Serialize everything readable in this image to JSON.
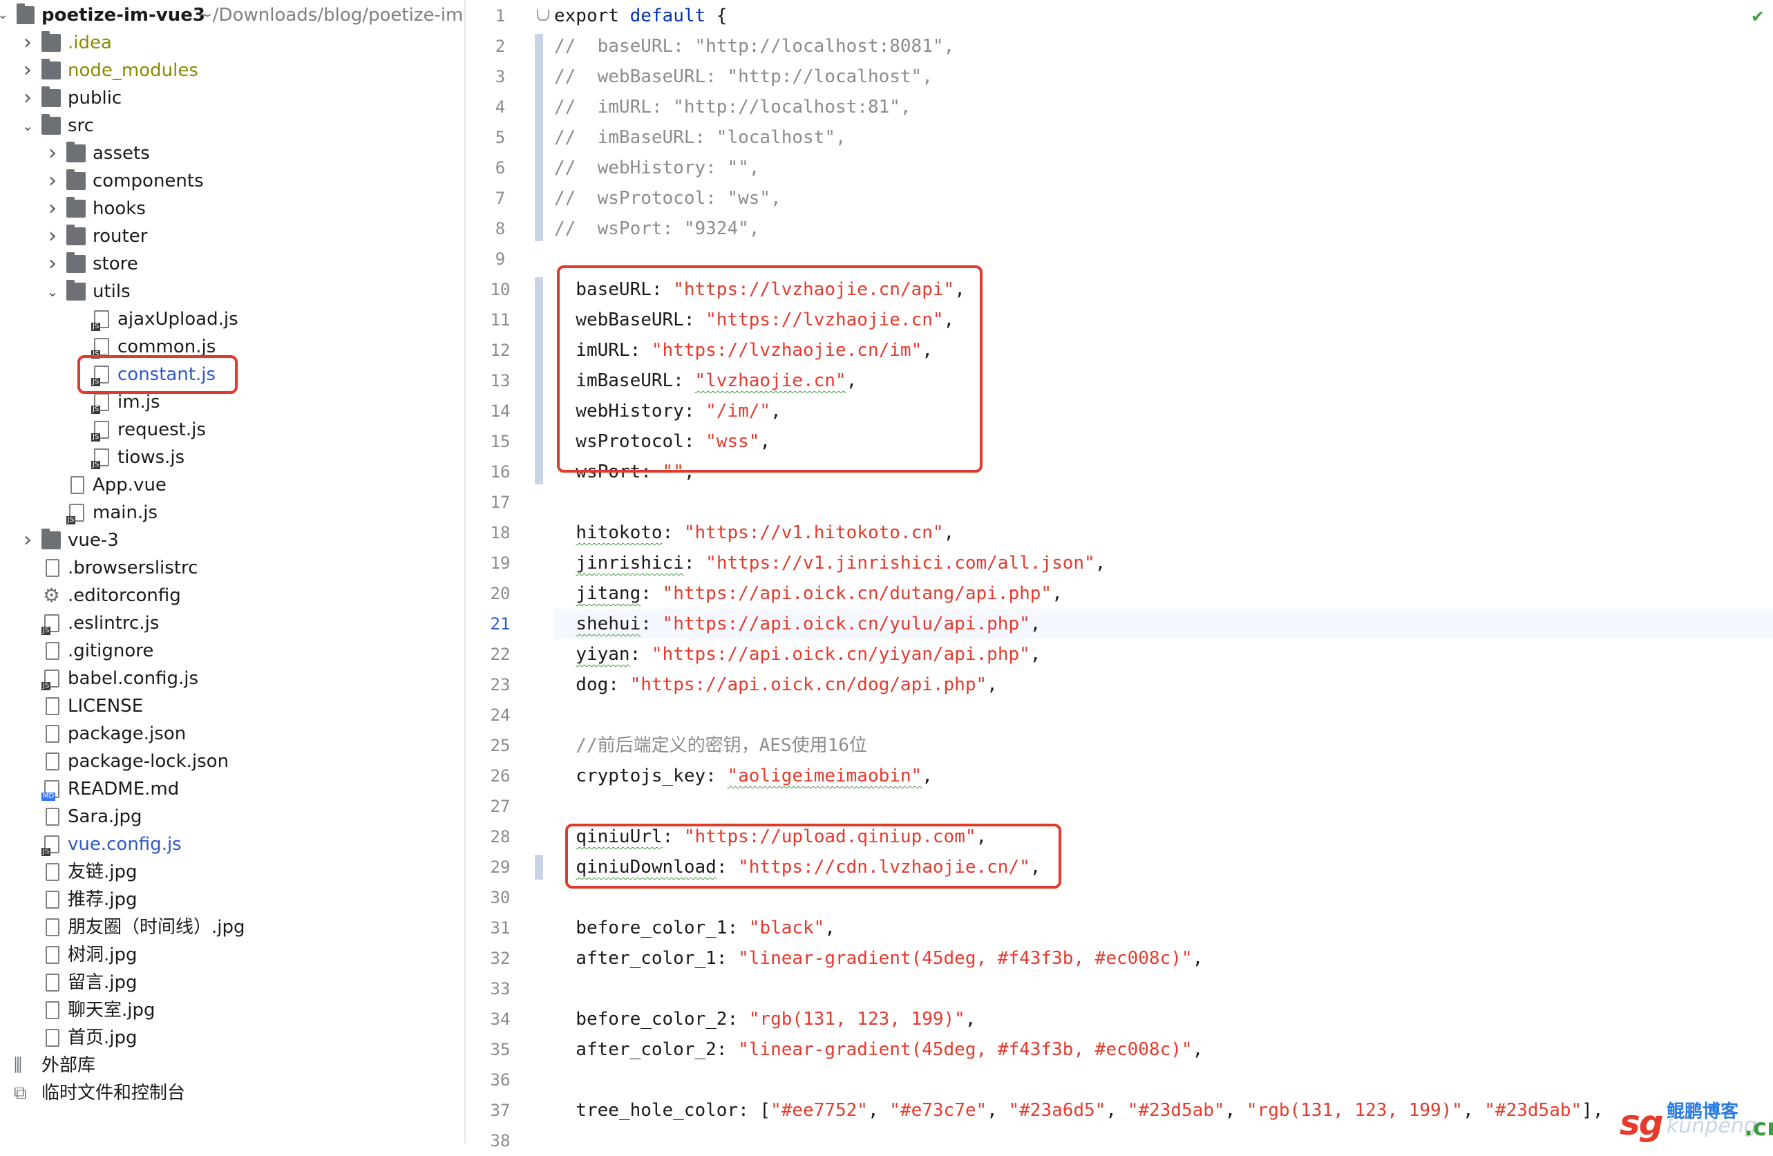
{
  "project": {
    "name": "poetize-im-vue3",
    "path": "~/Downloads/blog/poetize-im-v"
  },
  "tree": [
    {
      "label": "poetize-im-vue3",
      "type": "root"
    },
    {
      "label": ".idea",
      "type": "folder",
      "depth": 1,
      "color": "#8a8a00"
    },
    {
      "label": "node_modules",
      "type": "folder",
      "depth": 1,
      "color": "#8a8a00"
    },
    {
      "label": "public",
      "type": "folder",
      "depth": 1
    },
    {
      "label": "src",
      "type": "folder",
      "depth": 1,
      "open": true
    },
    {
      "label": "assets",
      "type": "folder",
      "depth": 2
    },
    {
      "label": "components",
      "type": "folder",
      "depth": 2
    },
    {
      "label": "hooks",
      "type": "folder",
      "depth": 2
    },
    {
      "label": "router",
      "type": "folder",
      "depth": 2
    },
    {
      "label": "store",
      "type": "folder",
      "depth": 2
    },
    {
      "label": "utils",
      "type": "folder",
      "depth": 2,
      "open": true
    },
    {
      "label": "ajaxUpload.js",
      "type": "js",
      "depth": 3
    },
    {
      "label": "common.js",
      "type": "js",
      "depth": 3
    },
    {
      "label": "constant.js",
      "type": "js",
      "depth": 3,
      "color": "#2e58c9"
    },
    {
      "label": "im.js",
      "type": "js",
      "depth": 3
    },
    {
      "label": "request.js",
      "type": "js",
      "depth": 3
    },
    {
      "label": "tiows.js",
      "type": "js",
      "depth": 3
    },
    {
      "label": "App.vue",
      "type": "file",
      "depth": 2
    },
    {
      "label": "main.js",
      "type": "js",
      "depth": 2
    },
    {
      "label": "vue-3",
      "type": "folder",
      "depth": 1
    },
    {
      "label": ".browserslistrc",
      "type": "file",
      "depth": 1
    },
    {
      "label": ".editorconfig",
      "type": "gear",
      "depth": 1
    },
    {
      "label": ".eslintrc.js",
      "type": "js",
      "depth": 1
    },
    {
      "label": ".gitignore",
      "type": "file",
      "depth": 1
    },
    {
      "label": "babel.config.js",
      "type": "js",
      "depth": 1
    },
    {
      "label": "LICENSE",
      "type": "file",
      "depth": 1
    },
    {
      "label": "package.json",
      "type": "file",
      "depth": 1
    },
    {
      "label": "package-lock.json",
      "type": "file",
      "depth": 1
    },
    {
      "label": "README.md",
      "type": "md",
      "depth": 1
    },
    {
      "label": "Sara.jpg",
      "type": "file",
      "depth": 1
    },
    {
      "label": "vue.config.js",
      "type": "js",
      "depth": 1,
      "color": "#2e58c9"
    },
    {
      "label": "友链.jpg",
      "type": "file",
      "depth": 1
    },
    {
      "label": "推荐.jpg",
      "type": "file",
      "depth": 1
    },
    {
      "label": "朋友圈（时间线）.jpg",
      "type": "file",
      "depth": 1
    },
    {
      "label": "树洞.jpg",
      "type": "file",
      "depth": 1
    },
    {
      "label": "留言.jpg",
      "type": "file",
      "depth": 1
    },
    {
      "label": "聊天室.jpg",
      "type": "file",
      "depth": 1
    },
    {
      "label": "首页.jpg",
      "type": "file",
      "depth": 1
    },
    {
      "label": "外部库",
      "type": "lib",
      "depth": 0
    },
    {
      "label": "临时文件和控制台",
      "type": "scratch",
      "depth": 0
    }
  ],
  "editor": {
    "current_line": 21,
    "lines": [
      [
        {
          "t": "export ",
          "c": "kw"
        },
        {
          "t": "default",
          "c": "k"
        },
        {
          "t": " {",
          "c": "p"
        }
      ],
      [
        {
          "t": "//  baseURL: \"http://localhost:8081\",",
          "c": "c"
        }
      ],
      [
        {
          "t": "//  webBaseURL: \"http://localhost\",",
          "c": "c"
        }
      ],
      [
        {
          "t": "//  imURL: \"http://localhost:81\",",
          "c": "c"
        }
      ],
      [
        {
          "t": "//  imBaseURL: \"localhost\",",
          "c": "c"
        }
      ],
      [
        {
          "t": "//  webHistory: \"\",",
          "c": "c"
        }
      ],
      [
        {
          "t": "//  wsProtocol: \"ws\",",
          "c": "c"
        }
      ],
      [
        {
          "t": "//  wsPort: \"9324\",",
          "c": "c"
        }
      ],
      [],
      [
        {
          "t": "  baseURL: ",
          "c": "p"
        },
        {
          "t": "\"https://lvzhaojie.cn/api\"",
          "c": "s"
        },
        {
          "t": ",",
          "c": "p"
        }
      ],
      [
        {
          "t": "  webBaseURL: ",
          "c": "p"
        },
        {
          "t": "\"https://lvzhaojie.cn\"",
          "c": "s"
        },
        {
          "t": ",",
          "c": "p"
        }
      ],
      [
        {
          "t": "  imURL: ",
          "c": "p"
        },
        {
          "t": "\"https://lvzhaojie.cn/im\"",
          "c": "s"
        },
        {
          "t": ",",
          "c": "p"
        }
      ],
      [
        {
          "t": "  imBaseURL: ",
          "c": "p"
        },
        {
          "t": "\"lvzhaojie.cn\"",
          "c": "s-u"
        },
        {
          "t": ",",
          "c": "p"
        }
      ],
      [
        {
          "t": "  webHistory: ",
          "c": "p"
        },
        {
          "t": "\"/im/\"",
          "c": "s"
        },
        {
          "t": ",",
          "c": "p"
        }
      ],
      [
        {
          "t": "  wsProtocol: ",
          "c": "p"
        },
        {
          "t": "\"wss\"",
          "c": "s"
        },
        {
          "t": ",",
          "c": "p"
        }
      ],
      [
        {
          "t": "  wsPort: ",
          "c": "p"
        },
        {
          "t": "\"\"",
          "c": "s"
        },
        {
          "t": ",",
          "c": "p"
        }
      ],
      [],
      [
        {
          "t": "  ",
          "c": "p"
        },
        {
          "t": "hitokoto",
          "c": "prop-u"
        },
        {
          "t": ": ",
          "c": "p"
        },
        {
          "t": "\"https://v1.hitokoto.cn\"",
          "c": "s"
        },
        {
          "t": ",",
          "c": "p"
        }
      ],
      [
        {
          "t": "  ",
          "c": "p"
        },
        {
          "t": "jinrishici",
          "c": "prop-u"
        },
        {
          "t": ": ",
          "c": "p"
        },
        {
          "t": "\"https://v1.jinrishici.com/all.json\"",
          "c": "s"
        },
        {
          "t": ",",
          "c": "p"
        }
      ],
      [
        {
          "t": "  ",
          "c": "p"
        },
        {
          "t": "jitang",
          "c": "prop-u"
        },
        {
          "t": ": ",
          "c": "p"
        },
        {
          "t": "\"https://api.oick.cn/dutang/api.php\"",
          "c": "s"
        },
        {
          "t": ",",
          "c": "p"
        }
      ],
      [
        {
          "t": "  ",
          "c": "p"
        },
        {
          "t": "shehui",
          "c": "prop-u"
        },
        {
          "t": ": ",
          "c": "p"
        },
        {
          "t": "\"https://api.oick.cn/yulu/api.php\"",
          "c": "s"
        },
        {
          "t": ",",
          "c": "p"
        }
      ],
      [
        {
          "t": "  ",
          "c": "p"
        },
        {
          "t": "yiyan",
          "c": "prop-u"
        },
        {
          "t": ": ",
          "c": "p"
        },
        {
          "t": "\"https://api.oick.cn/yiyan/api.php\"",
          "c": "s"
        },
        {
          "t": ",",
          "c": "p"
        }
      ],
      [
        {
          "t": "  dog: ",
          "c": "p"
        },
        {
          "t": "\"https://api.oick.cn/dog/api.php\"",
          "c": "s"
        },
        {
          "t": ",",
          "c": "p"
        }
      ],
      [],
      [
        {
          "t": "  //前后端定义的密钥，AES使用16位",
          "c": "c"
        }
      ],
      [
        {
          "t": "  cryptojs_key: ",
          "c": "p"
        },
        {
          "t": "\"aoligeimeimaobin\"",
          "c": "s-u"
        },
        {
          "t": ",",
          "c": "p"
        }
      ],
      [],
      [
        {
          "t": "  ",
          "c": "p"
        },
        {
          "t": "qiniuUrl",
          "c": "prop-u"
        },
        {
          "t": ": ",
          "c": "p"
        },
        {
          "t": "\"https://upload.qiniup.com\"",
          "c": "s"
        },
        {
          "t": ",",
          "c": "p"
        }
      ],
      [
        {
          "t": "  ",
          "c": "p"
        },
        {
          "t": "qiniuDownload",
          "c": "prop-u"
        },
        {
          "t": ": ",
          "c": "p"
        },
        {
          "t": "\"https://cdn.lvzhaojie.cn/\"",
          "c": "s"
        },
        {
          "t": ",",
          "c": "p"
        }
      ],
      [],
      [
        {
          "t": "  before_color_1: ",
          "c": "p"
        },
        {
          "t": "\"black\"",
          "c": "s"
        },
        {
          "t": ",",
          "c": "p"
        }
      ],
      [
        {
          "t": "  after_color_1: ",
          "c": "p"
        },
        {
          "t": "\"linear-gradient(45deg, #f43f3b, #ec008c)\"",
          "c": "s"
        },
        {
          "t": ",",
          "c": "p"
        }
      ],
      [],
      [
        {
          "t": "  before_color_2: ",
          "c": "p"
        },
        {
          "t": "\"rgb(131, 123, 199)\"",
          "c": "s"
        },
        {
          "t": ",",
          "c": "p"
        }
      ],
      [
        {
          "t": "  after_color_2: ",
          "c": "p"
        },
        {
          "t": "\"linear-gradient(45deg, #f43f3b, #ec008c)\"",
          "c": "s"
        },
        {
          "t": ",",
          "c": "p"
        }
      ],
      [],
      [
        {
          "t": "  tree_hole_color: [",
          "c": "p"
        },
        {
          "t": "\"#ee7752\"",
          "c": "s"
        },
        {
          "t": ", ",
          "c": "p"
        },
        {
          "t": "\"#e73c7e\"",
          "c": "s"
        },
        {
          "t": ", ",
          "c": "p"
        },
        {
          "t": "\"#23a6d5\"",
          "c": "s"
        },
        {
          "t": ", ",
          "c": "p"
        },
        {
          "t": "\"#23d5ab\"",
          "c": "s"
        },
        {
          "t": ", ",
          "c": "p"
        },
        {
          "t": "\"rgb(131, 123, 199)\"",
          "c": "s"
        },
        {
          "t": ", ",
          "c": "p"
        },
        {
          "t": "\"#23d5ab\"",
          "c": "s"
        },
        {
          "t": "],",
          "c": "p"
        }
      ],
      []
    ]
  },
  "watermark": {
    "logo": "sg",
    "name": "鲲鹏博客",
    "domain": "kunpeng",
    "tld": ".cn"
  },
  "colors": {
    "highlight_box": "#e03a2a",
    "string": "#e53a2c",
    "keyword": "#0033b3",
    "comment": "#8c8c8c"
  }
}
